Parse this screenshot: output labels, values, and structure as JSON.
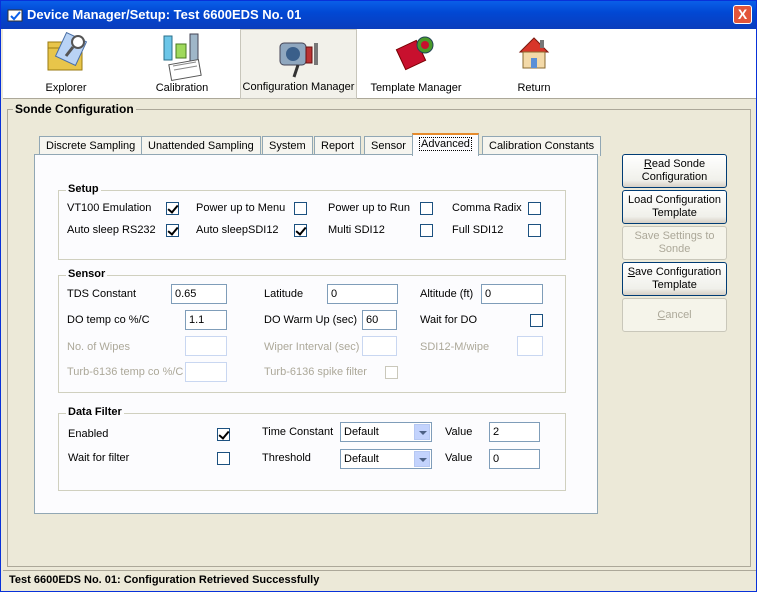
{
  "window": {
    "title": "Device Manager/Setup: Test 6600EDS No. 01",
    "close_label": "X"
  },
  "toolbar": {
    "items": [
      {
        "label": "Explorer",
        "icon": "explorer-icon"
      },
      {
        "label": "Calibration",
        "icon": "calibration-icon"
      },
      {
        "label": "Configuration Manager",
        "icon": "configuration-manager-icon",
        "selected": true
      },
      {
        "label": "Template Manager",
        "icon": "template-manager-icon"
      },
      {
        "label": "Return",
        "icon": "return-icon"
      }
    ]
  },
  "sonde": {
    "group_title": "Sonde Configuration",
    "tabs": [
      {
        "label": "Discrete Sampling"
      },
      {
        "label": "Unattended Sampling"
      },
      {
        "label": "System"
      },
      {
        "label": "Report"
      },
      {
        "label": "Sensor"
      },
      {
        "label": "Advanced",
        "active": true
      },
      {
        "label": "Calibration Constants"
      }
    ]
  },
  "setup": {
    "title": "Setup",
    "vt100": {
      "label": "VT100 Emulation",
      "checked": true
    },
    "power_menu": {
      "label": "Power up to Menu",
      "checked": false
    },
    "power_run": {
      "label": "Power up to Run",
      "checked": false
    },
    "comma_radix": {
      "label": "Comma Radix",
      "checked": false
    },
    "auto_rs232": {
      "label": "Auto sleep RS232",
      "checked": true
    },
    "auto_sdi12": {
      "label": "Auto sleepSDI12",
      "checked": true
    },
    "multi_sdi12": {
      "label": "Multi SDI12",
      "checked": false
    },
    "full_sdi12": {
      "label": "Full SDI12",
      "checked": false
    }
  },
  "sensor": {
    "title": "Sensor",
    "tds_label": "TDS Constant",
    "tds_value": "0.65",
    "latitude_label": "Latitude",
    "latitude_value": "0",
    "altitude_label": "Altitude (ft)",
    "altitude_value": "0",
    "do_temp_label": "DO temp co %/C",
    "do_temp_value": "1.1",
    "do_warm_label": "DO Warm Up (sec)",
    "do_warm_value": "60",
    "wait_do_label": "Wait for DO",
    "wipes_label": "No. of Wipes",
    "wipes_value": "",
    "wiper_interval_label": "Wiper Interval (sec)",
    "wiper_interval_value": "",
    "sdi12_wipe_label": "SDI12-M/wipe",
    "sdi12_wipe_value": "",
    "turb_temp_label": "Turb-6136 temp co %/C",
    "turb_temp_value": "",
    "turb_spike_label": "Turb-6136 spike filter"
  },
  "filter": {
    "title": "Data Filter",
    "enabled_label": "Enabled",
    "wait_label": "Wait for filter",
    "time_constant_label": "Time Constant",
    "time_constant_value": "Default",
    "threshold_label": "Threshold",
    "threshold_value": "Default",
    "value_label": "Value",
    "tc_value": "2",
    "th_value": "0"
  },
  "buttons": {
    "read_pre": "R",
    "read_rest": "ead Sonde",
    "read_line2": "Configuration",
    "load_line1": "Load Configuration",
    "load_line2": "Template",
    "save_settings_line1": "Save Settings to",
    "save_settings_line2": "Sonde",
    "save_config_pre": "S",
    "save_config_rest": "ave Configuration",
    "save_config_line2": "Template",
    "cancel_pre": "C",
    "cancel_rest": "ancel"
  },
  "status": {
    "text": "Test 6600EDS No. 01: Configuration Retrieved Successfully"
  }
}
